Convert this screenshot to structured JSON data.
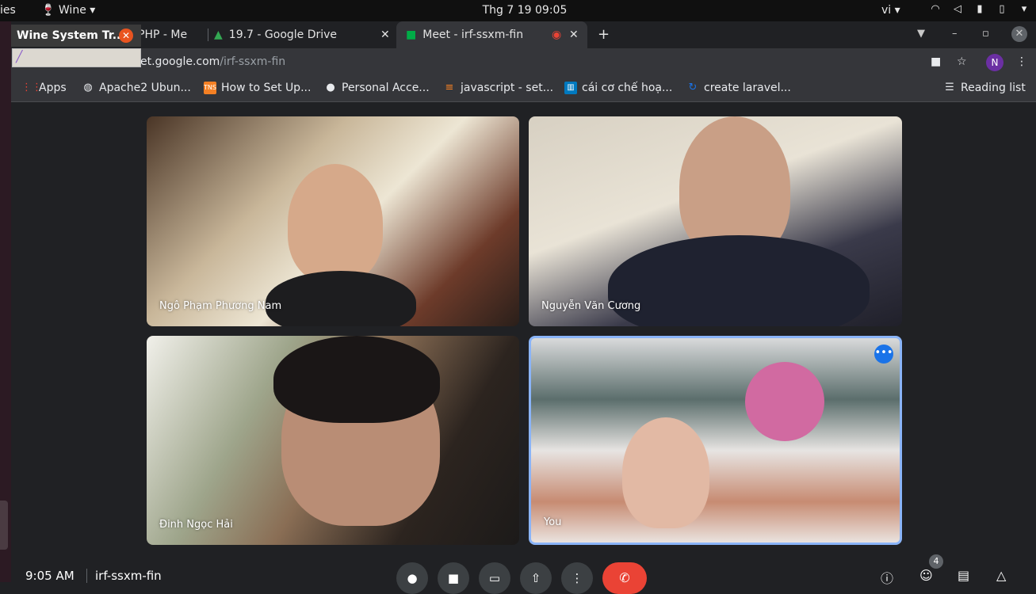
{
  "system_bar": {
    "left_fragment": "ies",
    "wine_menu": "Wine",
    "clock": "Thg 7 19  09:05",
    "lang": "vi"
  },
  "tabs": [
    {
      "label": "PHP - Me"
    },
    {
      "label": "19.7 - Google Drive"
    },
    {
      "label": "Meet - irf-ssxm-fin"
    }
  ],
  "wine_popup": {
    "title": "Wine System Tr..."
  },
  "omnibox": {
    "host": "et.google.com",
    "path": "/irf-ssxm-fin"
  },
  "account_initial": "N",
  "bookmarks": [
    {
      "label": "Apps"
    },
    {
      "label": "Apache2 Ubun..."
    },
    {
      "label": "How to Set Up..."
    },
    {
      "label": "Personal Acce..."
    },
    {
      "label": "javascript - set..."
    },
    {
      "label": "cái cơ chế hoạ..."
    },
    {
      "label": "create laravel..."
    }
  ],
  "reading_list": "Reading list",
  "participants": [
    {
      "name": "Ngô Phạm Phương Nam"
    },
    {
      "name": "Nguyễn Văn Cương"
    },
    {
      "name": "Đinh Ngọc Hải"
    },
    {
      "name": "You"
    }
  ],
  "meeting": {
    "time": "9:05 AM",
    "code": "irf-ssxm-fin",
    "people_count": "4"
  },
  "colors": {
    "hangup": "#ea4335",
    "active_speaker_border": "#8ab4f8",
    "accent": "#1a73e8"
  }
}
